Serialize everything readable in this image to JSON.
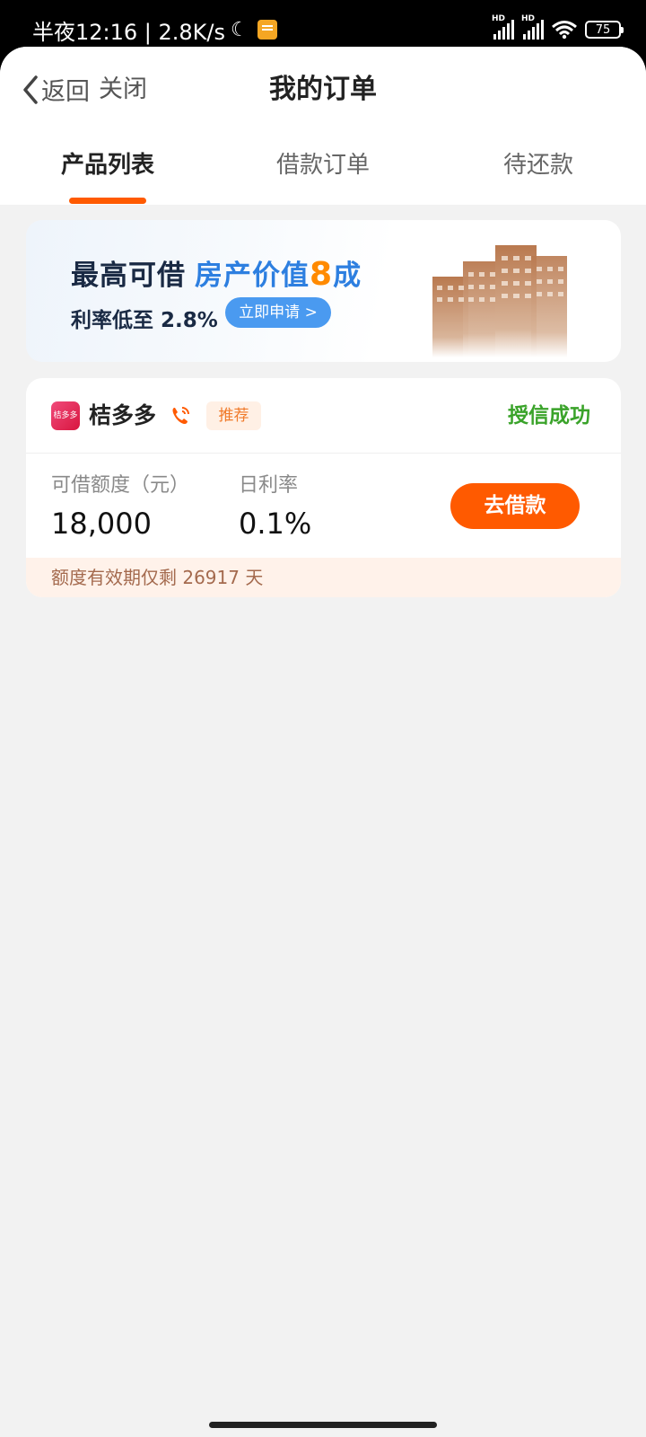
{
  "status_bar": {
    "time": "半夜12:16 | 2.8K/s",
    "battery": "75",
    "icons": [
      "moon-icon",
      "notification-icon",
      "signal-icon",
      "signal-icon",
      "wifi-icon",
      "battery-icon"
    ]
  },
  "header": {
    "back_label": "返回",
    "close_label": "关闭",
    "title": "我的订单"
  },
  "tabs": [
    {
      "label": "产品列表",
      "active": true
    },
    {
      "label": "借款订单",
      "active": false
    },
    {
      "label": "待还款",
      "active": false
    }
  ],
  "banner": {
    "line1_prefix": "最高可借",
    "line1_highlight": "房产价值",
    "line1_number": "8",
    "line1_suffix": "成",
    "line2": "利率低至 2.8%",
    "apply_label": "立即申请 >"
  },
  "product": {
    "logo_text": "桔多多",
    "name": "桔多多",
    "tag": "推荐",
    "status": "授信成功",
    "amount_label": "可借额度（元）",
    "amount_value": "18,000",
    "rate_label": "日利率",
    "rate_value": "0.1%",
    "action_label": "去借款",
    "validity_text": "额度有效期仅剩 26917 天"
  },
  "colors": {
    "accent": "#ff5a00",
    "success": "#3aa32a",
    "banner_blue": "#2d7fe0"
  }
}
